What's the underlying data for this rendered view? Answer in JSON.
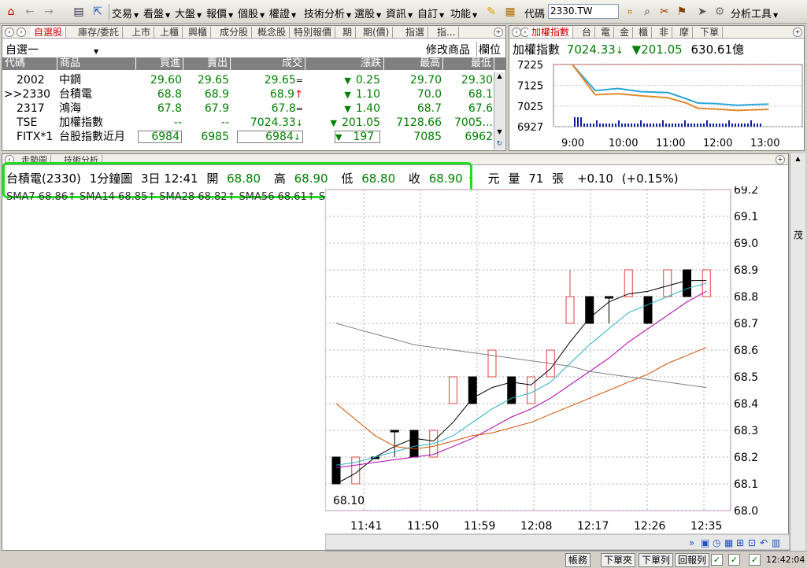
{
  "toolbar": {
    "menus": [
      {
        "label": "交易"
      },
      {
        "label": "看盤"
      },
      {
        "label": "大盤"
      },
      {
        "label": "報價"
      },
      {
        "label": "個股"
      },
      {
        "label": "權證"
      },
      {
        "label": "技術分析"
      },
      {
        "label": "選股"
      },
      {
        "label": "資訊"
      },
      {
        "label": "自訂"
      },
      {
        "label": "功能"
      }
    ],
    "symbol_label": "代碼",
    "symbol_value": "2330.TW",
    "analysis_tools": "分析工具"
  },
  "watchlist": {
    "tabs": [
      "自選股",
      "庫存/委託",
      "上市",
      "上櫃",
      "興櫃",
      "成分股",
      "概念股",
      "特別報價",
      "期",
      "期(價)",
      "指選",
      "指..."
    ],
    "group": "自選一",
    "edit_label": "修改商品",
    "columns_label": "欄位",
    "headers": {
      "code": "代碼",
      "name": "商品",
      "bid": "買進",
      "ask": "賣出",
      "last": "成交",
      "change": "漲跌",
      "high": "最高",
      "low": "最低"
    },
    "rows": [
      {
        "code": "2002",
        "name": "中鋼",
        "bid": "29.60",
        "ask": "29.65",
        "last": "29.65",
        "last_mark": "=",
        "change": "0.25",
        "change_mark": "▼",
        "high": "29.70",
        "low": "29.30"
      },
      {
        "code": ">>2330",
        "name": "台積電",
        "bid": "68.8",
        "ask": "68.9",
        "last": "68.9",
        "last_mark": "↑",
        "change": "1.10",
        "change_mark": "▼",
        "high": "70.0",
        "low": "68.1"
      },
      {
        "code": "2317",
        "name": "鴻海",
        "bid": "67.8",
        "ask": "67.9",
        "last": "67.8",
        "last_mark": "=",
        "change": "1.40",
        "change_mark": "▼",
        "high": "68.7",
        "low": "67.6"
      },
      {
        "code": "TSE",
        "name": "加權指數",
        "bid": "--",
        "ask": "--",
        "last": "7024.33",
        "last_mark": "↓",
        "change": "201.05",
        "change_mark": "▼",
        "high": "7128.66",
        "low": "7005..."
      },
      {
        "code": "FITX*1",
        "name": "台股指數近月",
        "bid": "6984",
        "ask": "6985",
        "last": "6984",
        "last_mark": "↓",
        "change": "197",
        "change_mark": "▼",
        "high": "7085",
        "low": "6962"
      }
    ]
  },
  "index_panel": {
    "tabs": [
      "加權指數",
      "台",
      "電",
      "金",
      "櫃",
      "非",
      "摩",
      "下單"
    ],
    "name": "加權指數",
    "value": "7024.33",
    "value_mark": "↓",
    "change_mark": "▼",
    "change": "201.05",
    "volume": "630.61億",
    "y_ticks": [
      "7225",
      "7125",
      "7025",
      "6927"
    ],
    "x_ticks": [
      "9:00",
      "10:00",
      "11:00",
      "12:00",
      "13:00"
    ]
  },
  "chart_panel": {
    "tabs": [
      "走勢圖",
      "技術分析"
    ],
    "info": {
      "name": "台積電(2330)",
      "period": "1分鐘圖",
      "datetime": "3日 12:41",
      "open_label": "開",
      "open": "68.80",
      "high_label": "高",
      "high": "68.90",
      "low_label": "低",
      "low": "68.80",
      "close_label": "收",
      "close": "68.90",
      "close_mark": "↑",
      "unit": "元",
      "volume_label": "量",
      "volume": "71",
      "volume_unit": "張",
      "change": "+0.10",
      "change_pct": "(+0.15%)"
    },
    "ma_line": "SMA7 68.86↑   SMA14 68.85↑   SMA28 68.82↑   SMA56 68.61↑   SMA112 68.46="
  },
  "chart_data": [
    {
      "type": "line",
      "title": "加權指數",
      "x": [
        "9:00",
        "9:15",
        "9:30",
        "10:00",
        "10:30",
        "11:00",
        "11:15",
        "11:30",
        "12:00",
        "12:30",
        "12:45"
      ],
      "series": [
        {
          "name": "",
          "color": "#2aa7d8",
          "values": [
            7225,
            7100,
            7110,
            7095,
            7090,
            7060,
            7040,
            7038,
            7030,
            7033,
            7035
          ]
        },
        {
          "name": "",
          "color": "#e08a2a",
          "values": [
            7225,
            7080,
            7085,
            7075,
            7065,
            7040,
            7015,
            7012,
            7005,
            7008,
            7010
          ]
        }
      ],
      "ylim": [
        6927,
        7225
      ],
      "y_ticks": [
        7225,
        7125,
        7025,
        6927
      ],
      "x_ticks": [
        "9:00",
        "10:00",
        "11:00",
        "12:00",
        "13:00"
      ]
    },
    {
      "type": "bar",
      "title": "",
      "subtype": "candlestick",
      "x_ticks": [
        "11:41",
        "11:50",
        "11:59",
        "12:08",
        "12:17",
        "12:26",
        "12:35"
      ],
      "ylim": [
        68.0,
        69.2
      ],
      "y_ticks": [
        68.0,
        68.1,
        68.2,
        68.3,
        68.4,
        68.5,
        68.6,
        68.7,
        68.8,
        68.9,
        69.0,
        69.1,
        69.2
      ],
      "min_label": "68.10",
      "candles": [
        {
          "o": 68.2,
          "c": 68.1,
          "h": 68.2,
          "l": 68.1
        },
        {
          "o": 68.1,
          "c": 68.2,
          "h": 68.2,
          "l": 68.1
        },
        {
          "o": 68.2,
          "c": 68.2,
          "h": 68.2,
          "l": 68.2
        },
        {
          "o": 68.3,
          "c": 68.3,
          "h": 68.3,
          "l": 68.2
        },
        {
          "o": 68.3,
          "c": 68.2,
          "h": 68.3,
          "l": 68.2
        },
        {
          "o": 68.2,
          "c": 68.3,
          "h": 68.3,
          "l": 68.2
        },
        {
          "o": 68.4,
          "c": 68.5,
          "h": 68.5,
          "l": 68.4
        },
        {
          "o": 68.5,
          "c": 68.4,
          "h": 68.5,
          "l": 68.4
        },
        {
          "o": 68.5,
          "c": 68.6,
          "h": 68.6,
          "l": 68.5
        },
        {
          "o": 68.5,
          "c": 68.4,
          "h": 68.5,
          "l": 68.4
        },
        {
          "o": 68.4,
          "c": 68.5,
          "h": 68.5,
          "l": 68.4
        },
        {
          "o": 68.5,
          "c": 68.6,
          "h": 68.6,
          "l": 68.5
        },
        {
          "o": 68.7,
          "c": 68.8,
          "h": 68.9,
          "l": 68.7
        },
        {
          "o": 68.8,
          "c": 68.7,
          "h": 68.8,
          "l": 68.7
        },
        {
          "o": 68.8,
          "c": 68.8,
          "h": 68.8,
          "l": 68.7
        },
        {
          "o": 68.8,
          "c": 68.9,
          "h": 68.9,
          "l": 68.8
        },
        {
          "o": 68.8,
          "c": 68.7,
          "h": 68.8,
          "l": 68.7
        },
        {
          "o": 68.8,
          "c": 68.9,
          "h": 68.9,
          "l": 68.8
        },
        {
          "o": 68.9,
          "c": 68.8,
          "h": 68.9,
          "l": 68.8
        },
        {
          "o": 68.8,
          "c": 68.9,
          "h": 68.9,
          "l": 68.8
        }
      ],
      "ma": [
        {
          "name": "SMA7",
          "color": "#000000",
          "values": [
            68.1,
            68.14,
            68.2,
            68.24,
            68.27,
            68.26,
            68.33,
            68.42,
            68.46,
            68.48,
            68.47,
            68.53,
            68.63,
            68.72,
            68.78,
            68.81,
            68.82,
            68.84,
            68.86,
            68.86
          ]
        },
        {
          "name": "SMA14",
          "color": "#2ab0c8",
          "values": [
            68.17,
            68.18,
            68.2,
            68.22,
            68.24,
            68.25,
            68.28,
            68.33,
            68.38,
            68.42,
            68.44,
            68.48,
            68.55,
            68.62,
            68.68,
            68.74,
            68.77,
            68.8,
            68.83,
            68.85
          ]
        },
        {
          "name": "SMA28",
          "color": "#b000b0",
          "values": [
            68.16,
            68.17,
            68.18,
            68.19,
            68.2,
            68.21,
            68.24,
            68.27,
            68.31,
            68.35,
            68.38,
            68.42,
            68.47,
            68.52,
            68.57,
            68.63,
            68.68,
            68.73,
            68.78,
            68.82
          ]
        },
        {
          "name": "SMA56",
          "color": "#d05000",
          "values": [
            68.4,
            68.34,
            68.28,
            68.24,
            68.23,
            68.24,
            68.26,
            68.28,
            68.29,
            68.31,
            68.33,
            68.36,
            68.39,
            68.42,
            68.45,
            68.48,
            68.51,
            68.55,
            68.58,
            68.61
          ]
        },
        {
          "name": "SMA112",
          "color": "#808080",
          "values": [
            68.7,
            68.68,
            68.66,
            68.64,
            68.62,
            68.61,
            68.6,
            68.59,
            68.58,
            68.57,
            68.56,
            68.55,
            68.54,
            68.52,
            68.51,
            68.5,
            68.49,
            68.48,
            68.47,
            68.46
          ]
        }
      ]
    }
  ],
  "status_bar": {
    "buttons": [
      "帳務",
      "下單夾",
      "下單列",
      "回報列"
    ],
    "time": "12:42:04"
  }
}
